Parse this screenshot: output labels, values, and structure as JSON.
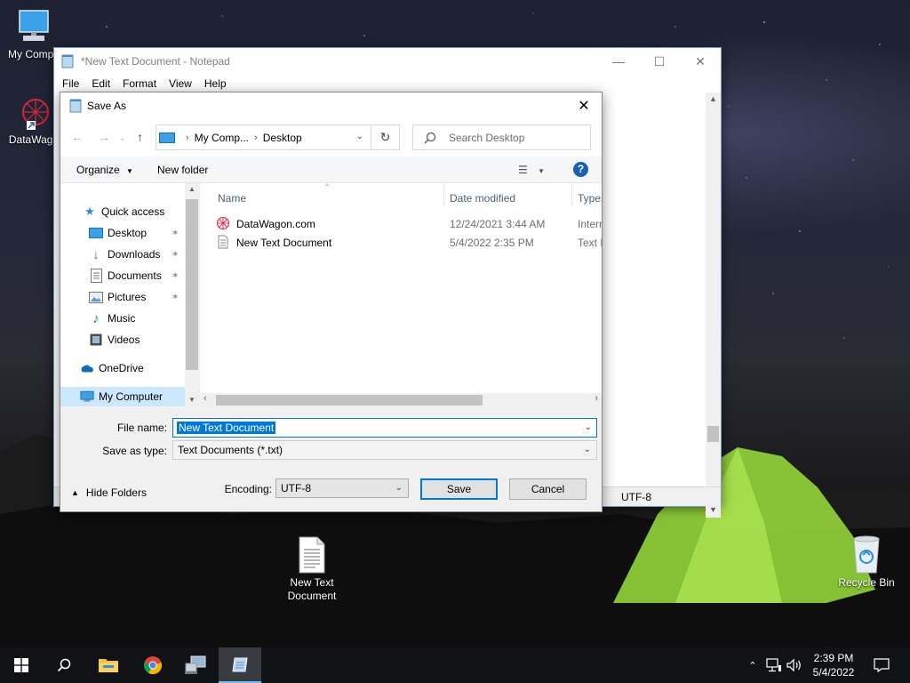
{
  "desktop": {
    "icons": [
      {
        "label": "My Compu"
      },
      {
        "label": "DataWago"
      },
      {
        "label": "New Text Document"
      },
      {
        "label": "Recycle Bin"
      }
    ]
  },
  "notepad": {
    "title": "*New Text Document - Notepad",
    "menu": [
      "File",
      "Edit",
      "Format",
      "View",
      "Help"
    ],
    "status_encoding": "UTF-8"
  },
  "dialog": {
    "title": "Save As",
    "breadcrumb": [
      "My Comp...",
      "Desktop"
    ],
    "search_placeholder": "Search Desktop",
    "organize_label": "Organize",
    "new_folder_label": "New folder",
    "help_label": "?",
    "nav_items": [
      {
        "label": "Quick access",
        "icon": "star-icon"
      },
      {
        "label": "Desktop",
        "icon": "desktop-icon",
        "pinned": true
      },
      {
        "label": "Downloads",
        "icon": "download-icon",
        "pinned": true
      },
      {
        "label": "Documents",
        "icon": "documents-icon",
        "pinned": true
      },
      {
        "label": "Pictures",
        "icon": "pictures-icon",
        "pinned": true
      },
      {
        "label": "Music",
        "icon": "music-icon"
      },
      {
        "label": "Videos",
        "icon": "videos-icon"
      },
      {
        "label": "OneDrive",
        "icon": "cloud-icon"
      },
      {
        "label": "My Computer",
        "icon": "computer-icon",
        "selected": true
      }
    ],
    "columns": [
      "Name",
      "Date modified",
      "Type"
    ],
    "files": [
      {
        "name": "DataWagon.com",
        "date": "12/24/2021 3:44 AM",
        "type": "Interr"
      },
      {
        "name": "New Text Document",
        "date": "5/4/2022 2:35 PM",
        "type": "Text D"
      }
    ],
    "file_name_label": "File name:",
    "file_name_value": "New Text Document",
    "save_as_type_label": "Save as type:",
    "save_as_type_value": "Text Documents (*.txt)",
    "hide_folders_label": "Hide Folders",
    "encoding_label": "Encoding:",
    "encoding_value": "UTF-8",
    "save_label": "Save",
    "cancel_label": "Cancel"
  },
  "taskbar": {
    "time": "2:39 PM",
    "date": "5/4/2022",
    "accent": "#76b9ed"
  },
  "colors": {
    "selection": "#0078d7",
    "nav_selected": "#cce8ff",
    "help_blue": "#1a5fb4"
  }
}
